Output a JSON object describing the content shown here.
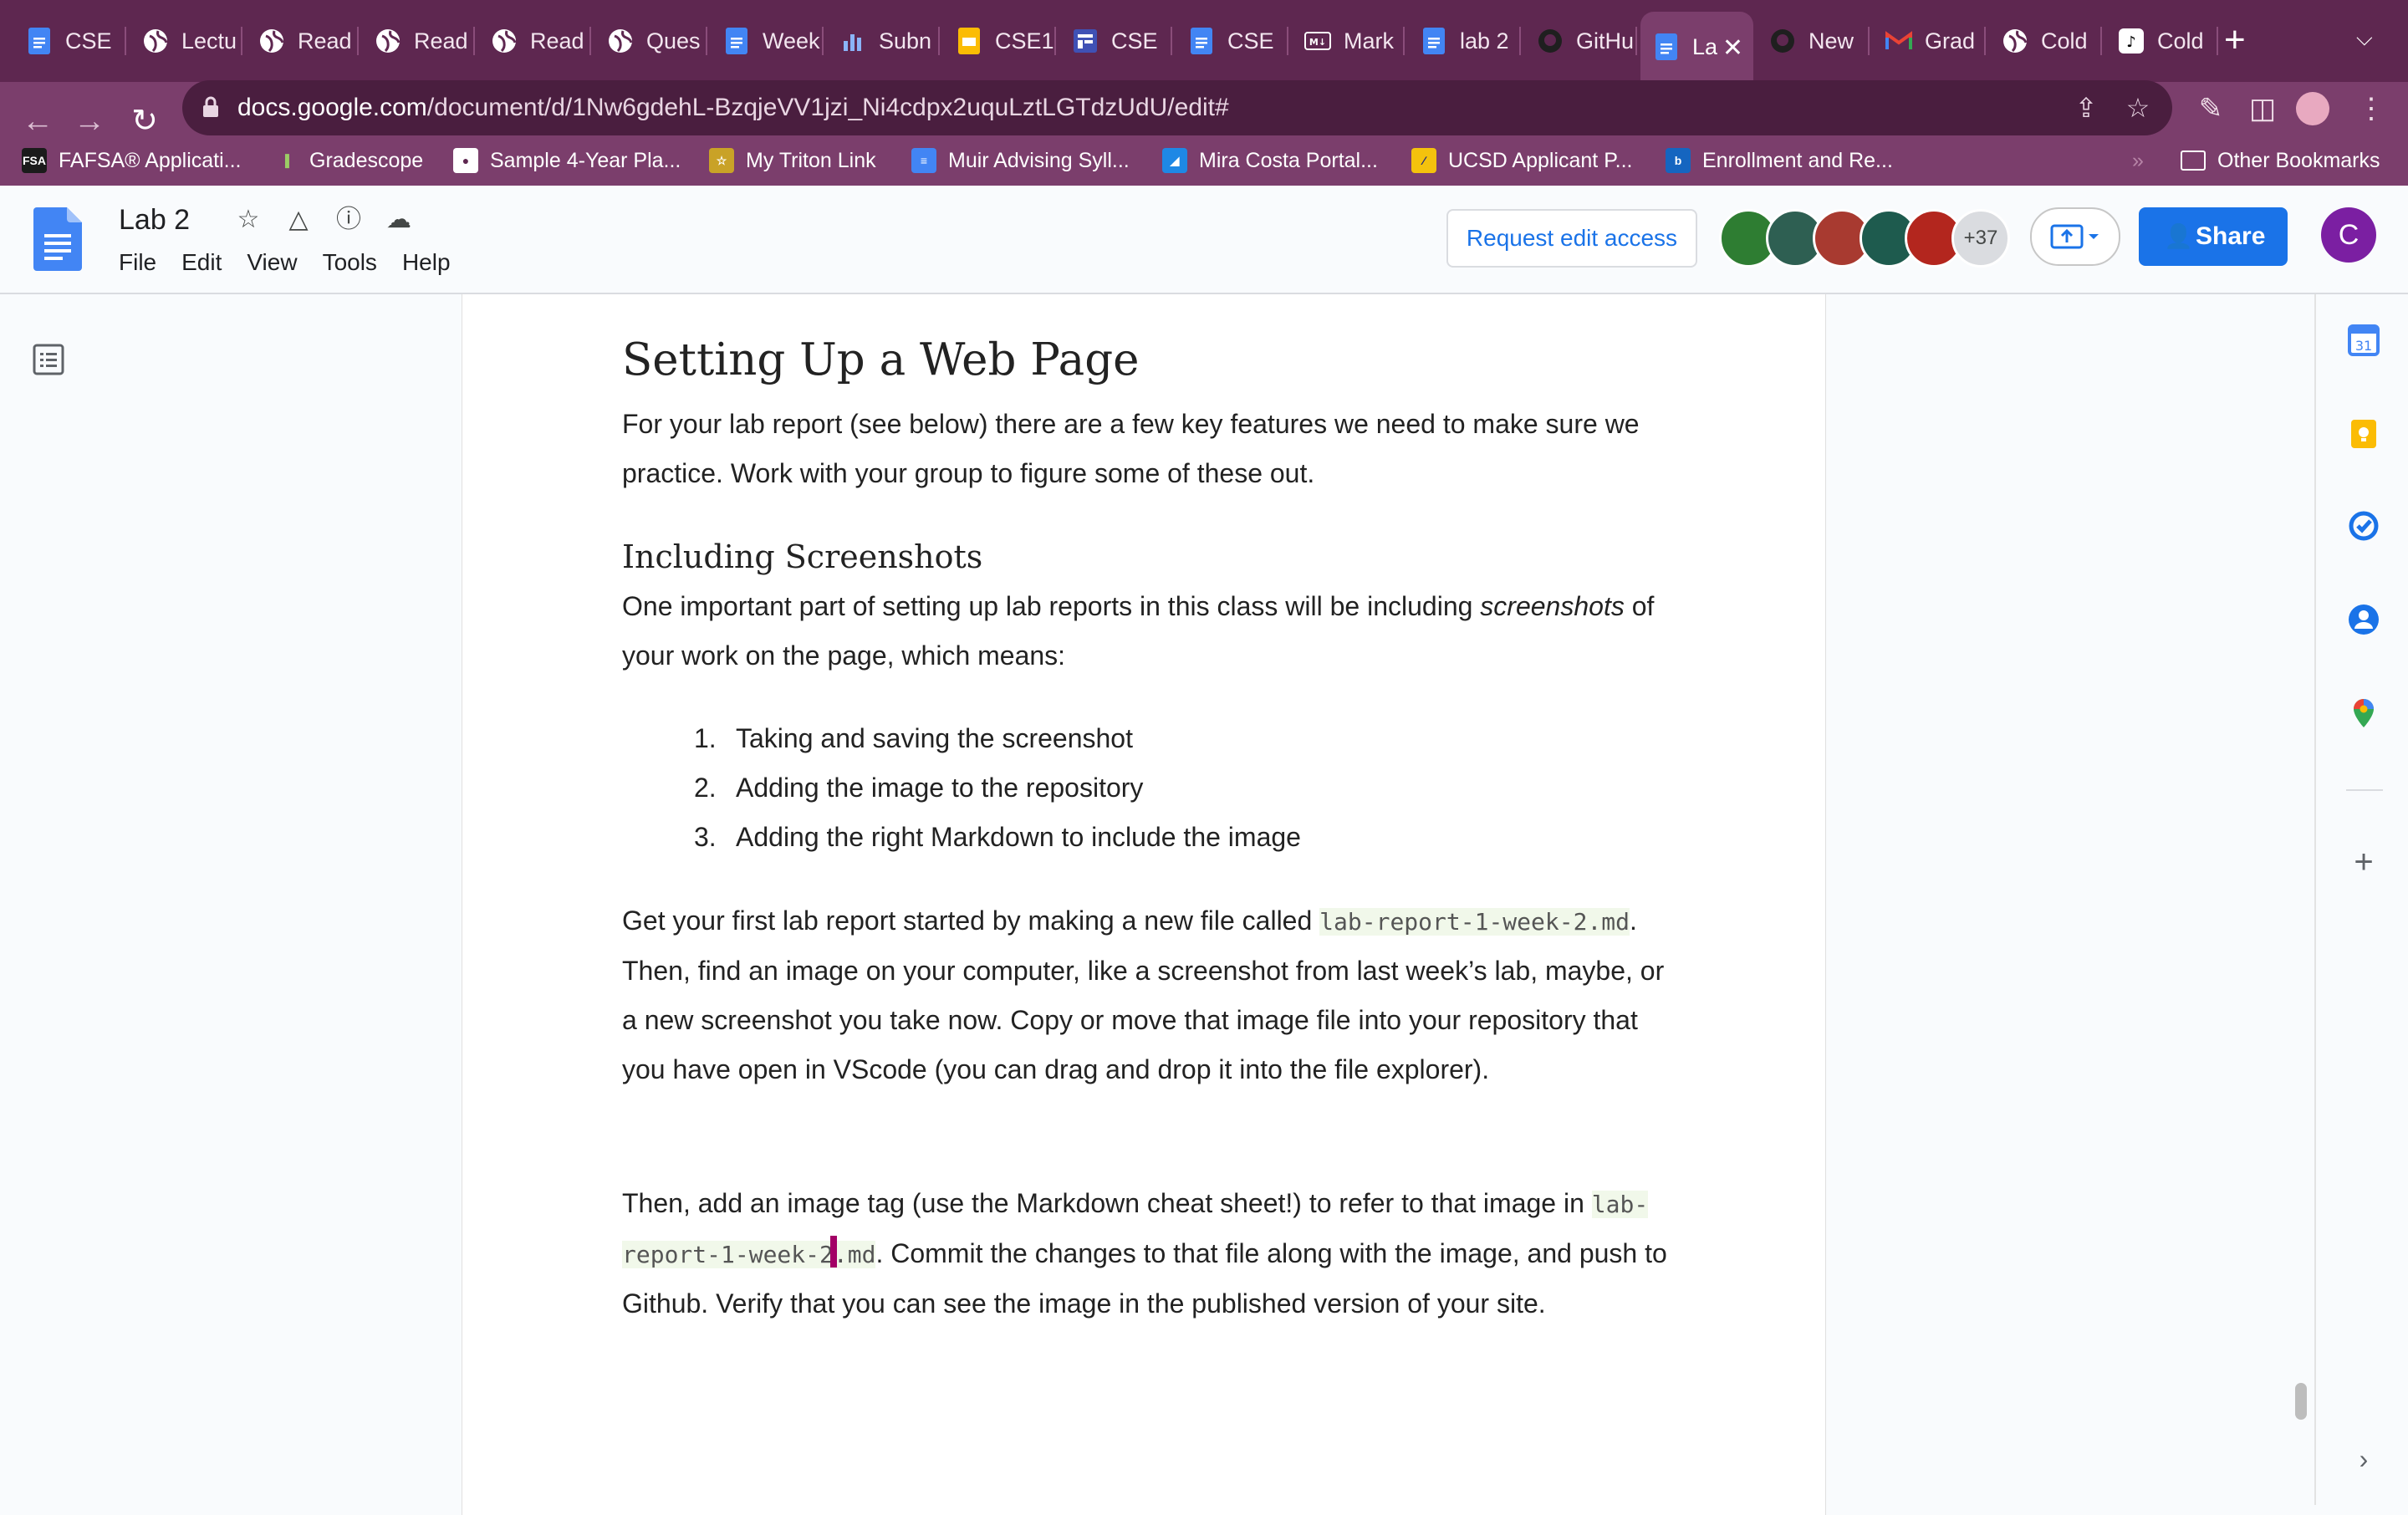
{
  "browser": {
    "tabs": [
      {
        "label": "CSE",
        "icon": "docs-icon"
      },
      {
        "label": "Lectu",
        "icon": "globe-icon"
      },
      {
        "label": "Read",
        "icon": "globe-icon"
      },
      {
        "label": "Read",
        "icon": "globe-icon"
      },
      {
        "label": "Read",
        "icon": "globe-icon"
      },
      {
        "label": "Ques",
        "icon": "globe-icon"
      },
      {
        "label": "Week",
        "icon": "docs-icon"
      },
      {
        "label": "Subn",
        "icon": "bar-chart-icon"
      },
      {
        "label": "CSE1",
        "icon": "slides-icon"
      },
      {
        "label": "CSE",
        "icon": "forms-icon"
      },
      {
        "label": "CSE",
        "icon": "docs-icon"
      },
      {
        "label": "Mark",
        "icon": "markdown-icon"
      },
      {
        "label": "lab 2",
        "icon": "docs-icon"
      },
      {
        "label": "GitHu",
        "icon": "github-icon"
      },
      {
        "label": "La",
        "icon": "docs-icon",
        "active": true
      },
      {
        "label": "New",
        "icon": "github-icon"
      },
      {
        "label": "Grad",
        "icon": "gmail-icon"
      },
      {
        "label": "Cold",
        "icon": "globe-icon"
      },
      {
        "label": "Cold",
        "icon": "tiktok-icon"
      }
    ],
    "url_host": "docs.google.com",
    "url_path": "/document/d/1Nw6gdehL-BzqjeVV1jzi_Ni4cdpx2uquLztLGTdzUdU/edit#",
    "bookmarks": [
      {
        "label": "FAFSA® Applicati...",
        "icon": "fafsa-icon"
      },
      {
        "label": "Gradescope",
        "icon": "gradescope-icon"
      },
      {
        "label": "Sample 4-Year Pla...",
        "icon": "globe-icon"
      },
      {
        "label": "My Triton Link",
        "icon": "triton-icon"
      },
      {
        "label": "Muir Advising Syll...",
        "icon": "docs-icon"
      },
      {
        "label": "Mira Costa Portal...",
        "icon": "miracosta-icon"
      },
      {
        "label": "UCSD Applicant P...",
        "icon": "ucsd-icon"
      },
      {
        "label": "Enrollment and Re...",
        "icon": "b-icon"
      }
    ],
    "other_bookmarks": "Other Bookmarks"
  },
  "docs": {
    "title": "Lab 2",
    "menu": [
      "File",
      "Edit",
      "View",
      "Tools",
      "Help"
    ],
    "request_edit": "Request edit access",
    "more_collaborators": "+37",
    "share": "Share",
    "user_initial": "C"
  },
  "content": {
    "heading": "Setting Up a Web Page",
    "intro": "For your lab report (see below) there are a few key features we need to make sure we practice. Work with your group to figure some of these out.",
    "subheading": "Including Screenshots",
    "screens_before": "One important part of setting up lab reports in this class will be including ",
    "screens_em": "screenshots",
    "screens_after": " of your work on the page, which means:",
    "list": [
      {
        "n": "1.",
        "text": "Taking and saving the screenshot"
      },
      {
        "n": "2.",
        "text": "Adding the image to the repository"
      },
      {
        "n": "3.",
        "text": "Adding the right Markdown to include the image"
      }
    ],
    "p3_before": "Get your first lab report started by making a new file called ",
    "p3_code": "lab-report-1-week-2.md",
    "p3_after": ". Then, find an image on your computer, like a screenshot from last week’s lab, maybe, or a new screenshot you take now. Copy or move that image file into your repository that you have open in VScode (you can drag and drop it into the file explorer).",
    "p4_before": "Then, add an image tag (use the Markdown cheat sheet!) to refer to that image in ",
    "p4_code_a": "lab-report-1-week-2",
    "p4_code_b": ".md",
    "p4_after": ". Commit the changes to that file along with the image, and push to Github. Verify that you can see the image in the published version of your site."
  },
  "colors": {
    "chrome": "#7b3e6c",
    "tabstrip": "#5e2750",
    "accent": "#1a73e8"
  }
}
